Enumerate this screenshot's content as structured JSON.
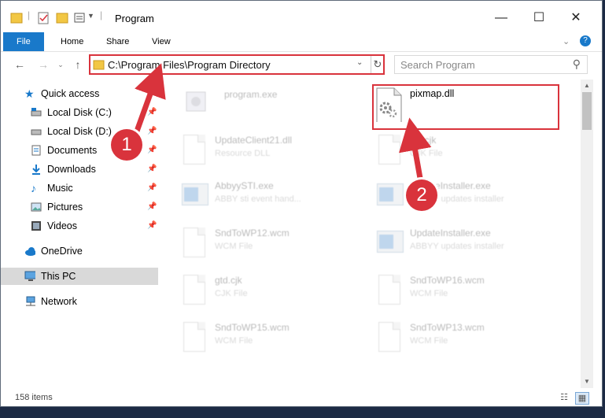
{
  "window": {
    "title": "Program"
  },
  "ribbon": {
    "tabs": [
      "File",
      "Home",
      "Share",
      "View"
    ]
  },
  "address": {
    "path": "C:\\Program Files\\Program Directory"
  },
  "search": {
    "placeholder": "Search Program"
  },
  "sidebar": {
    "items": [
      {
        "label": "Quick access",
        "icon": "star-icon",
        "pinned": false
      },
      {
        "label": "Local Disk (C:)",
        "icon": "drive-icon",
        "pinned": true
      },
      {
        "label": "Local Disk (D:)",
        "icon": "drive-icon",
        "pinned": true
      },
      {
        "label": "Documents",
        "icon": "documents-icon",
        "pinned": true
      },
      {
        "label": "Downloads",
        "icon": "download-icon",
        "pinned": true
      },
      {
        "label": "Music",
        "icon": "music-icon",
        "pinned": true
      },
      {
        "label": "Pictures",
        "icon": "pictures-icon",
        "pinned": true
      },
      {
        "label": "Videos",
        "icon": "videos-icon",
        "pinned": true
      },
      {
        "label": "OneDrive",
        "icon": "cloud-icon",
        "pinned": false
      },
      {
        "label": "This PC",
        "icon": "computer-icon",
        "pinned": false,
        "selected": true
      },
      {
        "label": "Network",
        "icon": "network-icon",
        "pinned": false
      }
    ]
  },
  "files": [
    {
      "name": "program.exe",
      "type": "",
      "icon": "exe-icon"
    },
    {
      "name": "pixmap.dll",
      "type": "",
      "icon": "dll-gear-icon"
    },
    {
      "name": "UpdateClient21.dll",
      "type": "Resource DLL",
      "icon": "dll-icon"
    },
    {
      "name": "file.cjk",
      "type": "CJK File",
      "icon": "document-icon"
    },
    {
      "name": "AbbyySTI.exe",
      "type": "ABBY sti event hand...",
      "icon": "app-icon"
    },
    {
      "name": "UpdateInstaller.exe",
      "type": "ABBYY updates installer",
      "icon": "app-icon"
    },
    {
      "name": "SndToWP12.wcm",
      "type": "WCM File",
      "icon": "document-icon"
    },
    {
      "name": "UpdateInstaller.exe",
      "type": "ABBYY updates installer",
      "icon": "app-icon"
    },
    {
      "name": "gtd.cjk",
      "type": "CJK File",
      "icon": "document-icon"
    },
    {
      "name": "SndToWP16.wcm",
      "type": "WCM File",
      "icon": "document-icon"
    },
    {
      "name": "SndToWP15.wcm",
      "type": "WCM File",
      "icon": "document-icon"
    },
    {
      "name": "SndToWP13.wcm",
      "type": "WCM File",
      "icon": "document-icon"
    }
  ],
  "status": {
    "count": "158 items"
  },
  "annotations": {
    "step1": "1",
    "step2": "2"
  },
  "colors": {
    "accent": "#1979ca",
    "highlight": "#d9333c"
  }
}
